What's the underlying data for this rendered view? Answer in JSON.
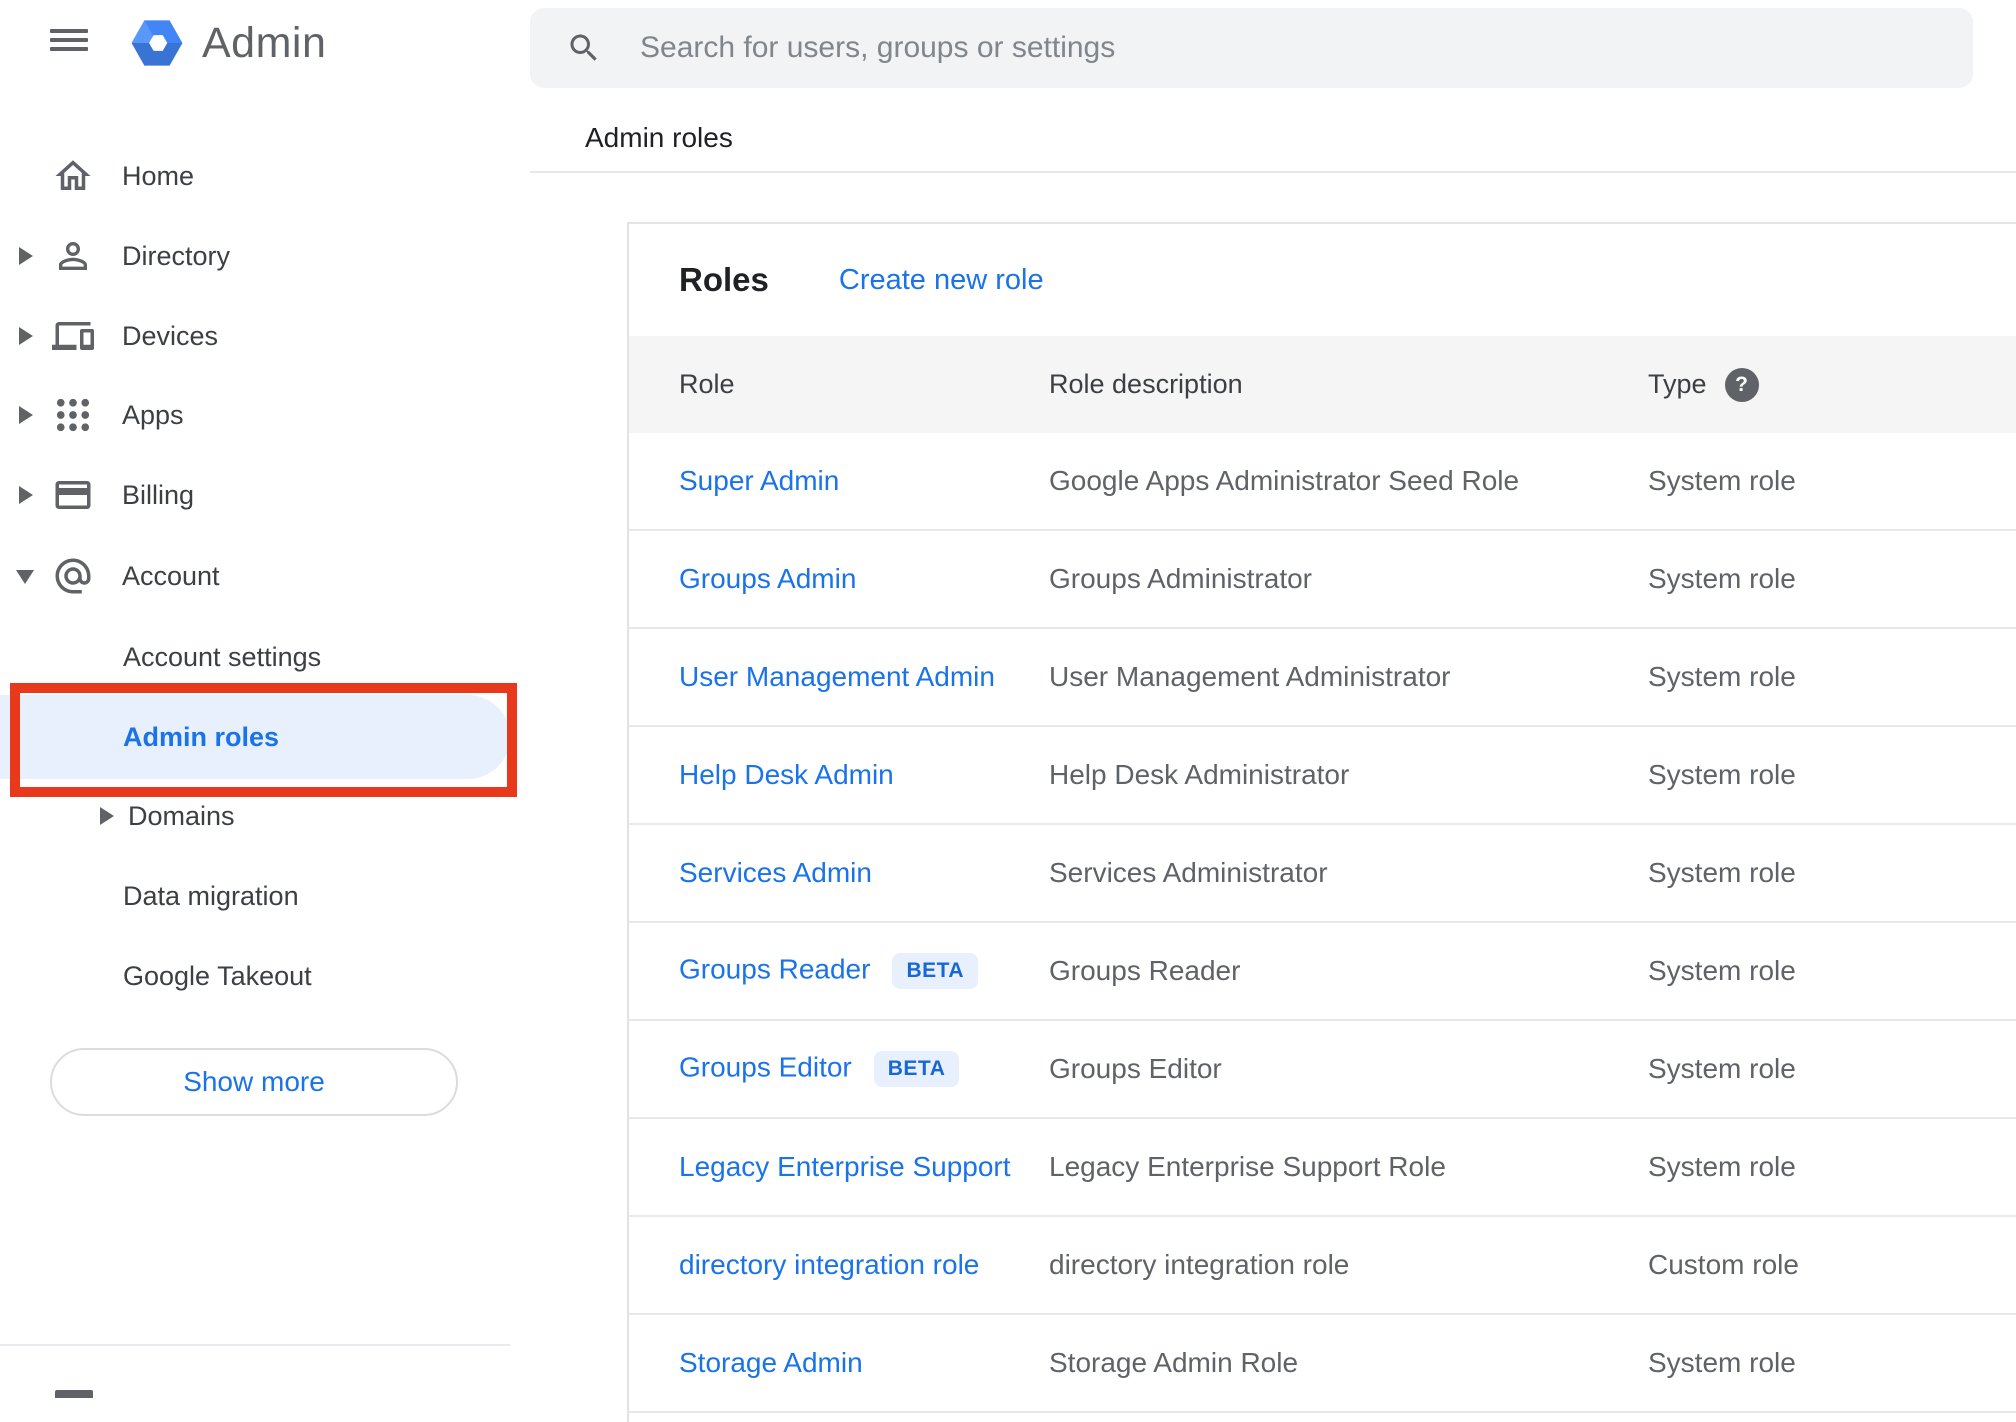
{
  "app": {
    "name": "Admin"
  },
  "search": {
    "placeholder": "Search for users, groups or settings"
  },
  "breadcrumb": {
    "label": "Admin roles"
  },
  "icons": {
    "help": "?"
  },
  "sidebar": {
    "items": [
      {
        "label": "Home"
      },
      {
        "label": "Directory"
      },
      {
        "label": "Devices"
      },
      {
        "label": "Apps"
      },
      {
        "label": "Billing"
      },
      {
        "label": "Account"
      }
    ],
    "account_children": [
      {
        "label": "Account settings"
      },
      {
        "label": "Admin roles",
        "selected": true
      },
      {
        "label": "Domains"
      },
      {
        "label": "Data migration"
      },
      {
        "label": "Google Takeout"
      }
    ],
    "show_more": "Show more"
  },
  "main": {
    "title": "Roles",
    "create_new_role": "Create new role",
    "columns": {
      "role": "Role",
      "description": "Role description",
      "type": "Type"
    },
    "beta_label": "BETA",
    "rows": [
      {
        "role": "Super Admin",
        "description": "Google Apps Administrator Seed Role",
        "type": "System role"
      },
      {
        "role": "Groups Admin",
        "description": "Groups Administrator",
        "type": "System role"
      },
      {
        "role": "User Management Admin",
        "description": "User Management Administrator",
        "type": "System role"
      },
      {
        "role": "Help Desk Admin",
        "description": "Help Desk Administrator",
        "type": "System role"
      },
      {
        "role": "Services Admin",
        "description": "Services Administrator",
        "type": "System role"
      },
      {
        "role": "Groups Reader",
        "beta": true,
        "description": "Groups Reader",
        "type": "System role"
      },
      {
        "role": "Groups Editor",
        "beta": true,
        "description": "Groups Editor",
        "type": "System role"
      },
      {
        "role": "Legacy Enterprise Support",
        "description": "Legacy Enterprise Support Role",
        "type": "System role"
      },
      {
        "role": "directory integration role",
        "description": "directory integration role",
        "type": "Custom role"
      },
      {
        "role": "Storage Admin",
        "description": "Storage Admin Role",
        "type": "System role"
      }
    ]
  },
  "colors": {
    "accent_blue": "#1a73e8",
    "selected_item_bg": "#e8f0fe",
    "annotation_red": "#e8391d",
    "beta_bg": "#e8f0fe",
    "beta_text": "#1967d2",
    "header_bg": "#f5f5f5",
    "searchbar_bg": "#f1f3f4"
  }
}
